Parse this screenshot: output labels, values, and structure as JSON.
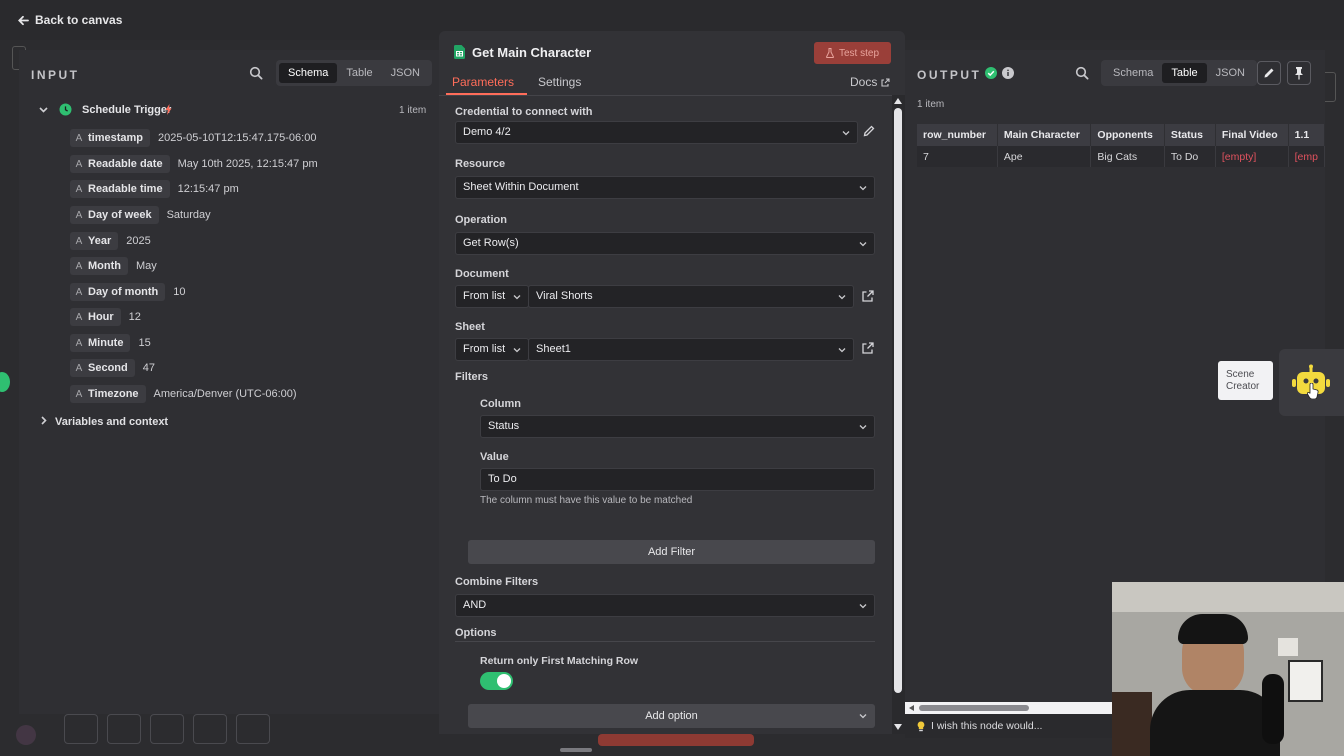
{
  "topbar": {
    "back_label": "Back to canvas"
  },
  "input": {
    "title": "INPUT",
    "view_tabs": [
      "Schema",
      "Table",
      "JSON"
    ],
    "active_view": "Schema",
    "trigger": {
      "name": "Schedule Trigger",
      "count": "1 item"
    },
    "fields": [
      {
        "type": "A",
        "name": "timestamp",
        "value": "2025-05-10T12:15:47.175-06:00"
      },
      {
        "type": "A",
        "name": "Readable date",
        "value": "May 10th 2025, 12:15:47 pm"
      },
      {
        "type": "A",
        "name": "Readable time",
        "value": "12:15:47 pm"
      },
      {
        "type": "A",
        "name": "Day of week",
        "value": "Saturday"
      },
      {
        "type": "A",
        "name": "Year",
        "value": "2025"
      },
      {
        "type": "A",
        "name": "Month",
        "value": "May"
      },
      {
        "type": "A",
        "name": "Day of month",
        "value": "10"
      },
      {
        "type": "A",
        "name": "Hour",
        "value": "12"
      },
      {
        "type": "A",
        "name": "Minute",
        "value": "15"
      },
      {
        "type": "A",
        "name": "Second",
        "value": "47"
      },
      {
        "type": "A",
        "name": "Timezone",
        "value": "America/Denver (UTC-06:00)"
      }
    ],
    "variables_label": "Variables and context"
  },
  "node": {
    "title": "Get Main Character",
    "test_step_label": "Test step",
    "tabs": {
      "parameters": "Parameters",
      "settings": "Settings",
      "docs": "Docs"
    },
    "credential": {
      "label": "Credential to connect with",
      "value": "Demo 4/2"
    },
    "resource": {
      "label": "Resource",
      "value": "Sheet Within Document"
    },
    "operation": {
      "label": "Operation",
      "value": "Get Row(s)"
    },
    "document": {
      "label": "Document",
      "mode": "From list",
      "value": "Viral Shorts"
    },
    "sheet": {
      "label": "Sheet",
      "mode": "From list",
      "value": "Sheet1"
    },
    "filters": {
      "label": "Filters",
      "column_label": "Column",
      "column_value": "Status",
      "value_label": "Value",
      "value_value": "To Do",
      "hint": "The column must have this value to be matched",
      "add_filter_label": "Add Filter"
    },
    "combine": {
      "label": "Combine Filters",
      "value": "AND"
    },
    "options": {
      "label": "Options",
      "return_first_label": "Return only First Matching Row",
      "return_first_on": true,
      "add_option_label": "Add option"
    }
  },
  "output": {
    "title": "OUTPUT",
    "count": "1 item",
    "view_tabs": [
      "Schema",
      "Table",
      "JSON"
    ],
    "active_view": "Table",
    "columns": [
      "row_number",
      "Main Character",
      "Opponents",
      "Status",
      "Final Video",
      "1.1"
    ],
    "rows": [
      [
        "7",
        "Ape",
        "Big Cats",
        "To Do",
        "[empty]",
        "[emp"
      ]
    ],
    "feedback_label": "I wish this node would..."
  },
  "canvas": {
    "tooltip": "Scene Creator"
  },
  "colors": {
    "accent": "#ff6d5a",
    "success": "#2fbf71",
    "sheets_green": "#21a464",
    "empty_red": "#e0525e"
  }
}
